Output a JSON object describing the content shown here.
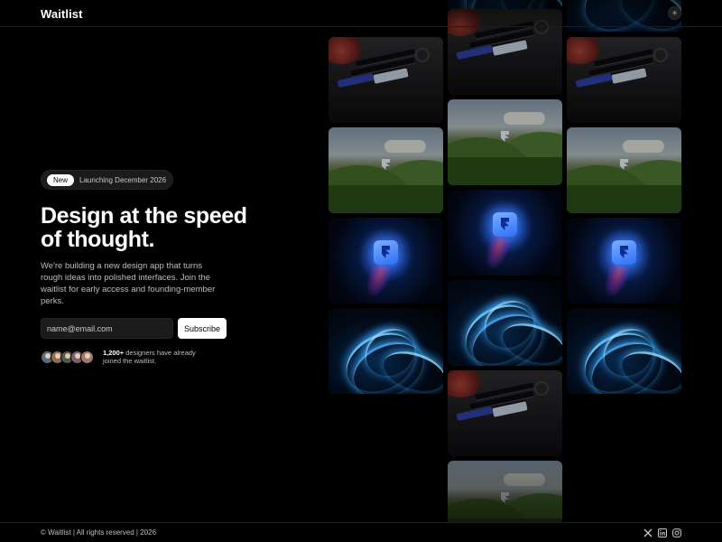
{
  "header": {
    "brand": "Waitlist",
    "theme_icon": "sun-icon",
    "theme_glyph": "☀"
  },
  "hero": {
    "badge_label": "New",
    "badge_text": "Launching December 2026",
    "headline": "Design at the speed of thought.",
    "description": "We're building a new design app that turns rough ideas into polished interfaces. Join the waitlist for early access and founding-member perks.",
    "email_placeholder": "name@email.com",
    "subscribe_label": "Subscribe",
    "proof_count": "1,200+",
    "proof_text": " designers have already joined the waitlist."
  },
  "avatars": [
    {
      "name": "avatar-1",
      "color": "#5b6b7a"
    },
    {
      "name": "avatar-2",
      "color": "#8a6d5a"
    },
    {
      "name": "avatar-3",
      "color": "#4e5a4a"
    },
    {
      "name": "avatar-4",
      "color": "#7a5f6e"
    },
    {
      "name": "avatar-5",
      "color": "#9a7a6a"
    }
  ],
  "gallery": {
    "tile_types": [
      "keyboard",
      "landscape",
      "app-icon",
      "wave"
    ]
  },
  "footer": {
    "copyright": "© Waitlist | All rights reserved | 2026",
    "social_icons": [
      "x-icon",
      "linkedin-icon",
      "instagram-icon"
    ]
  },
  "colors": {
    "background": "#000000",
    "text": "#ffffff",
    "muted": "#bdbdbd",
    "input_bg": "#1b1b1b",
    "accent_blue": "#2f6ef5"
  }
}
